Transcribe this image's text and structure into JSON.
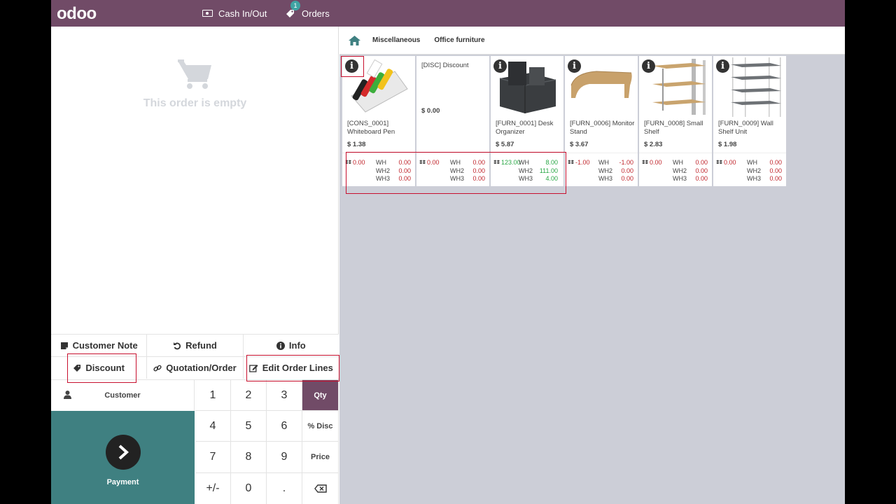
{
  "header": {
    "logo": "odoo",
    "cash_label": "Cash In/Out",
    "orders_label": "Orders",
    "orders_count": "1"
  },
  "order": {
    "empty_text": "This order is empty"
  },
  "controls": {
    "customer_note": "Customer Note",
    "refund": "Refund",
    "info": "Info",
    "discount": "Discount",
    "quotation": "Quotation/Order",
    "edit_lines": "Edit Order Lines"
  },
  "numpad": {
    "customer": "Customer",
    "payment": "Payment",
    "keys": [
      "1",
      "2",
      "3",
      "4",
      "5",
      "6",
      "7",
      "8",
      "9",
      "+/-",
      "0",
      "."
    ],
    "modes": [
      "Qty",
      "% Disc",
      "Price"
    ]
  },
  "categories": [
    "Miscellaneous",
    "Office furniture"
  ],
  "products": [
    {
      "name": "[CONS_0001] Whiteboard Pen",
      "price": "$ 1.38",
      "total": "0.00",
      "wh": [
        "0.00",
        "0.00",
        "0.00"
      ]
    },
    {
      "name": "[DISC] Discount",
      "price": "$ 0.00",
      "total": "0.00",
      "wh": [
        "0.00",
        "0.00",
        "0.00"
      ]
    },
    {
      "name": "[FURN_0001] Desk Organizer",
      "price": "$ 5.87",
      "total": "123.00",
      "wh": [
        "8.00",
        "111.00",
        "4.00"
      ]
    },
    {
      "name": "[FURN_0006] Monitor Stand",
      "price": "$ 3.67",
      "total": "-1.00",
      "wh": [
        "-1.00",
        "0.00",
        "0.00"
      ]
    },
    {
      "name": "[FURN_0008] Small Shelf",
      "price": "$ 2.83",
      "total": "0.00",
      "wh": [
        "0.00",
        "0.00",
        "0.00"
      ]
    },
    {
      "name": "[FURN_0009] Wall Shelf Unit",
      "price": "$ 1.98",
      "total": "0.00",
      "wh": [
        "0.00",
        "0.00",
        "0.00"
      ]
    }
  ],
  "warehouses": [
    "WH",
    "WH2",
    "WH3"
  ],
  "colors": {
    "brand": "#714b67",
    "payment": "#3f8081",
    "stock_negative": "#c0252c",
    "stock_positive": "#28a745",
    "highlight": "#c8102e"
  }
}
